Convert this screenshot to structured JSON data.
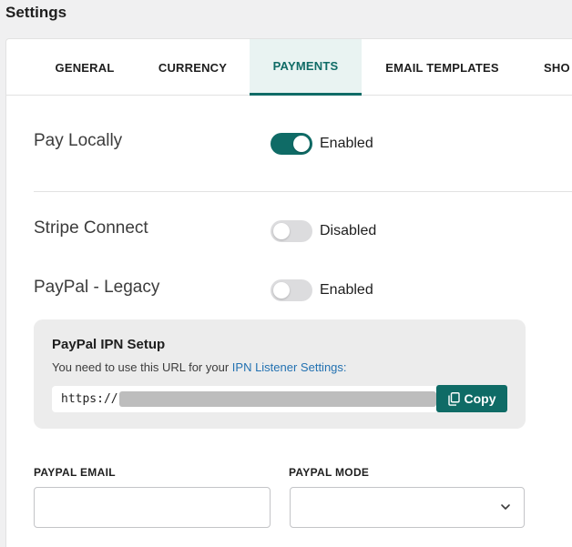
{
  "page": {
    "title": "Settings"
  },
  "tabs": [
    {
      "label": "GENERAL",
      "active": false
    },
    {
      "label": "CURRENCY",
      "active": false
    },
    {
      "label": "PAYMENTS",
      "active": true
    },
    {
      "label": "EMAIL TEMPLATES",
      "active": false
    },
    {
      "label": "SHO",
      "active": false
    }
  ],
  "payments": {
    "pay_locally": {
      "label": "Pay Locally",
      "enabled": true,
      "state_text": "Enabled"
    },
    "stripe_connect": {
      "label": "Stripe Connect",
      "enabled": false,
      "state_text": "Disabled"
    },
    "paypal_legacy": {
      "label": "PayPal - Legacy",
      "enabled": false,
      "state_text": "Enabled"
    }
  },
  "ipn": {
    "title": "PayPal IPN Setup",
    "text": "You need to use this URL for your ",
    "link": "IPN Listener Settings:",
    "url_prefix": "https://",
    "copy_label": "Copy"
  },
  "fields": {
    "paypal_email": {
      "label": "PAYPAL EMAIL",
      "value": ""
    },
    "paypal_mode": {
      "label": "PAYPAL MODE",
      "value": ""
    }
  },
  "colors": {
    "accent": "#0f6b66",
    "link": "#2271b1",
    "background": "#f0f0f1"
  },
  "icons": {
    "copy": "copy-icon",
    "chevron": "chevron-down-icon"
  }
}
